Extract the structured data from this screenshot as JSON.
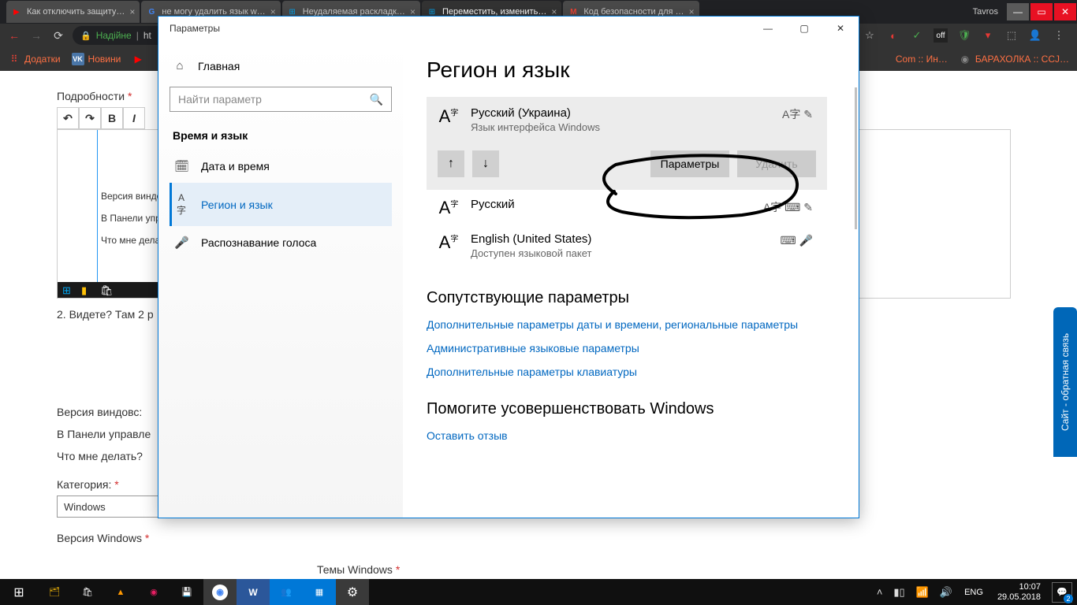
{
  "browser": {
    "tabs": [
      {
        "favicon": "▶",
        "favcolor": "#ff0000",
        "title": "Как отключить защиту…"
      },
      {
        "favicon": "G",
        "favcolor": "#4285f4",
        "title": "не могу удалить язык w…"
      },
      {
        "favicon": "⊞",
        "favcolor": "#00a4ef",
        "title": "Неудаляемая раскладк…"
      },
      {
        "favicon": "⊞",
        "favcolor": "#00a4ef",
        "title": "Переместить, изменить…"
      },
      {
        "favicon": "M",
        "favcolor": "#ea4335",
        "title": "Код безопасности для …"
      }
    ],
    "user": "Tavros",
    "addr_secure": "Надійне",
    "addr_url_prefix": "ht",
    "bookmarks": {
      "apps": "Додатки",
      "items": [
        {
          "icon": "VK",
          "bg": "#4a76a8",
          "label": "Новини"
        },
        {
          "icon": "▶",
          "bg": "#ff0000",
          "label": ""
        },
        {
          "icon": "",
          "bg": "",
          "label": "Com :: Ин…"
        },
        {
          "icon": "",
          "bg": "",
          "label": "БАРАХОЛКА :: CCJ…"
        }
      ]
    }
  },
  "page": {
    "details_label": "Подробности",
    "toolbar": {
      "undo": "↶",
      "redo": "↷",
      "bold": "B",
      "italic": "I"
    },
    "editor_lines": [
      "Версия виндо",
      "В Панели упра",
      "Что мне делат"
    ],
    "after_editor": "2. Видете? Там 2 р",
    "full_lines": [
      "Версия виндовс:",
      "В Панели управле",
      "Что мне делать?"
    ],
    "category_label": "Категория:",
    "category_value": "Windows",
    "win_ver_label": "Версия Windows",
    "themes_label": "Темы Windows",
    "feedback": "Сайт - обратная связь"
  },
  "settings": {
    "title": "Параметры",
    "home": "Главная",
    "search_placeholder": "Найти параметр",
    "section": "Время и язык",
    "nav": [
      {
        "icon": "🗓",
        "label": "Дата и время"
      },
      {
        "icon": "A字",
        "label": "Регион и язык"
      },
      {
        "icon": "🎤",
        "label": "Распознавание голоса"
      }
    ],
    "heading": "Регион и язык",
    "langs": [
      {
        "name": "Русский (Украина)",
        "sub": "Язык интерфейса Windows",
        "icons": "A字 ✎"
      },
      {
        "name": "Русский",
        "sub": "",
        "icons": "A字 ⌨ ✎"
      },
      {
        "name": "English (United States)",
        "sub": "Доступен языковой пакет",
        "icons": "⌨ 🎤"
      }
    ],
    "actions": {
      "up": "↑",
      "down": "↓",
      "params": "Параметры",
      "delete": "Удалить"
    },
    "related_h": "Сопутствующие параметры",
    "related_links": [
      "Дополнительные параметры даты и времени, региональные параметры",
      "Административные языковые параметры",
      "Дополнительные параметры клавиатуры"
    ],
    "improve_h": "Помогите усовершенствовать Windows",
    "improve_link": "Оставить отзыв"
  },
  "taskbar": {
    "lang": "ENG",
    "time": "10:07",
    "date": "29.05.2018",
    "notif_count": "2"
  }
}
